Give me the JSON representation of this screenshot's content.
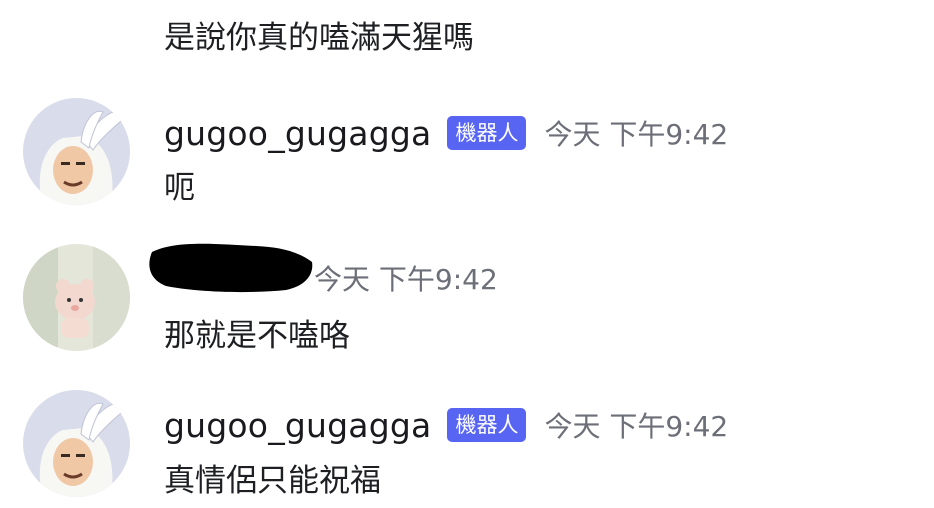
{
  "messages": [
    {
      "text": "是說你真的嗑滿天猩嗎"
    },
    {
      "username": "gugoo_gugagga",
      "tag": "機器人",
      "time": "今天 下午9:42",
      "text": "呃"
    },
    {
      "username": "",
      "time": "今天 下午9:42",
      "text": "那就是不嗑咯"
    },
    {
      "username": "gugoo_gugagga",
      "tag": "機器人",
      "time": "今天 下午9:42",
      "text": "真情侶只能祝福"
    }
  ],
  "colors": {
    "bot_tag": "#5865f2",
    "timestamp": "#6d6f78",
    "text": "#1e1f22"
  }
}
